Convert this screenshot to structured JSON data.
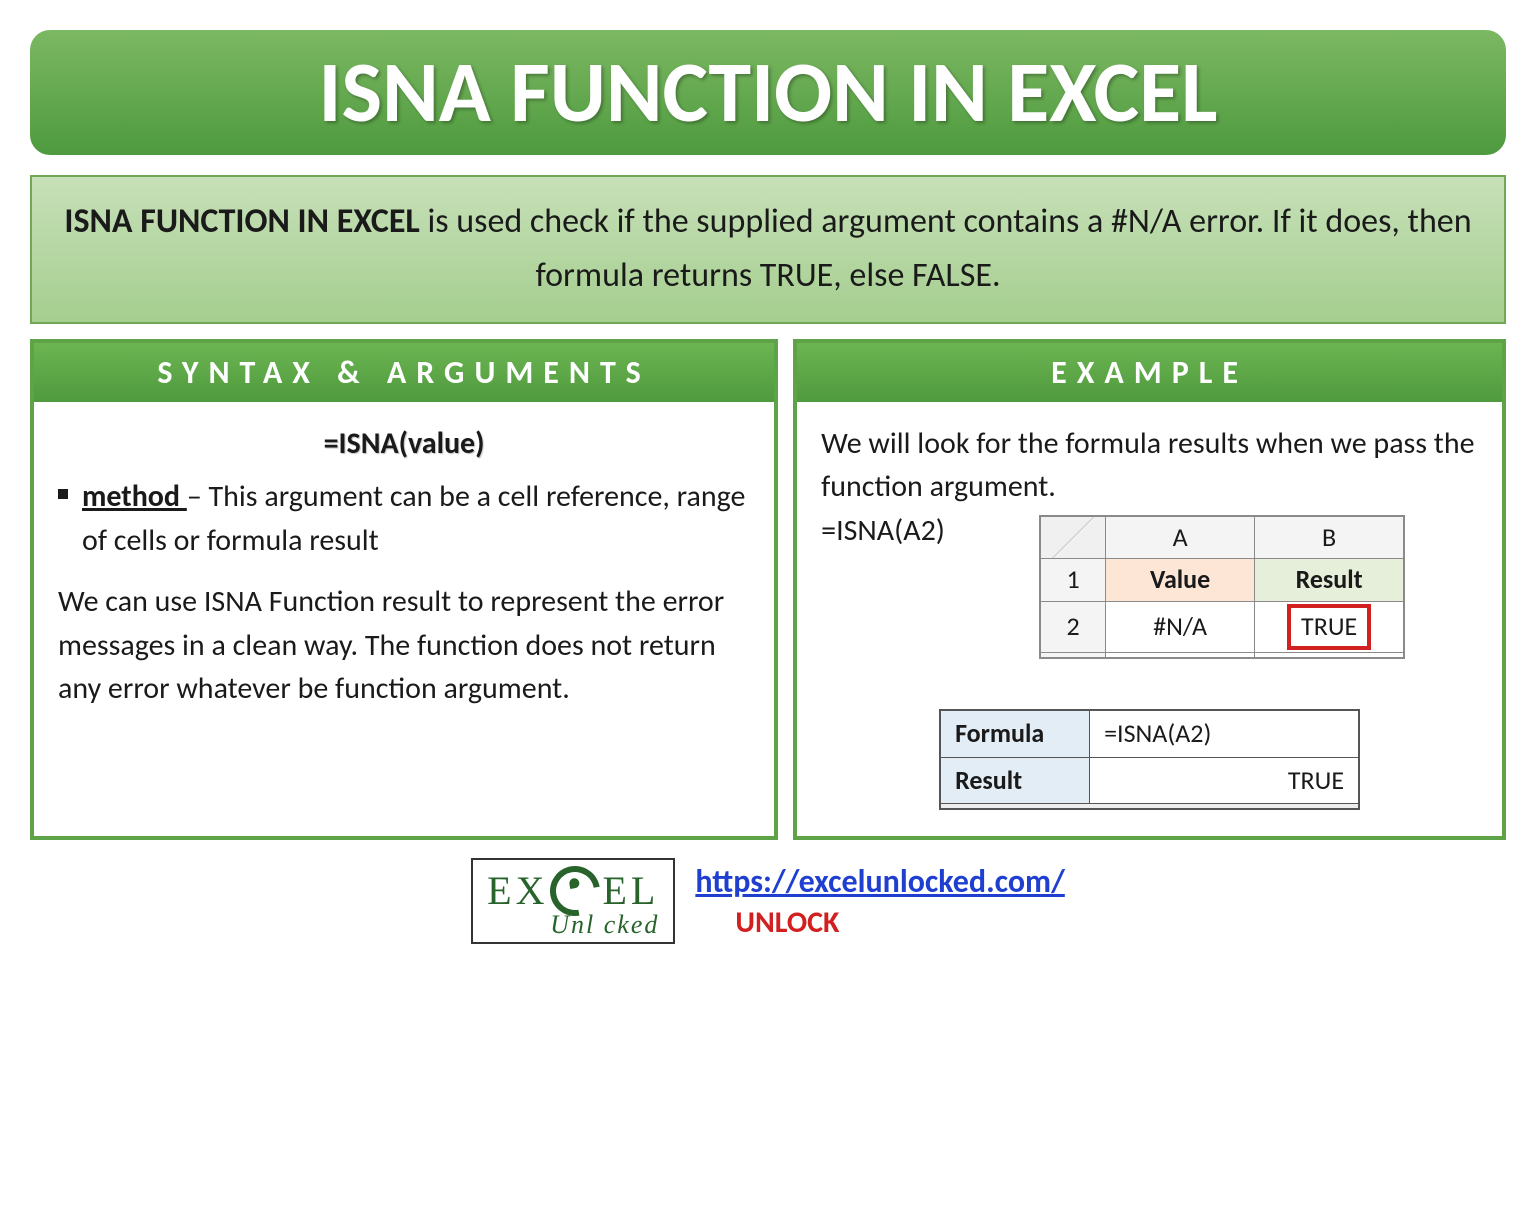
{
  "title": "ISNA FUNCTION IN EXCEL",
  "description": {
    "bold": "ISNA FUNCTION IN EXCEL",
    "rest": " is used check if the supplied argument contains a #N/A error. If it does, then formula returns TRUE, else FALSE."
  },
  "left": {
    "header": "SYNTAX & ARGUMENTS",
    "syntax": "=ISNA(value)",
    "arg_name": "method ",
    "arg_desc": "– This argument can be a cell reference, range of cells or formula result",
    "note": "We can use ISNA Function result to represent the error messages in a clean way. The function does not return any error whatever be function argument."
  },
  "right": {
    "header": "EXAMPLE",
    "intro": "We will look for the formula results when we pass the function argument.",
    "formula_inline": "=ISNA(A2)",
    "sheet": {
      "colA": "A",
      "colB": "B",
      "row1": "1",
      "row2": "2",
      "h_value": "Value",
      "h_result": "Result",
      "v_a2": "#N/A",
      "v_b2": "TRUE"
    },
    "ftable": {
      "l1": "Formula",
      "v1": "=ISNA(A2)",
      "l2": "Result",
      "v2": "TRUE"
    }
  },
  "footer": {
    "logo_top_pre": "EX",
    "logo_top_post": "EL",
    "logo_bottom": "Unl   cked",
    "link": "https://excelunlocked.com/",
    "unlock": "UNLOCK"
  }
}
